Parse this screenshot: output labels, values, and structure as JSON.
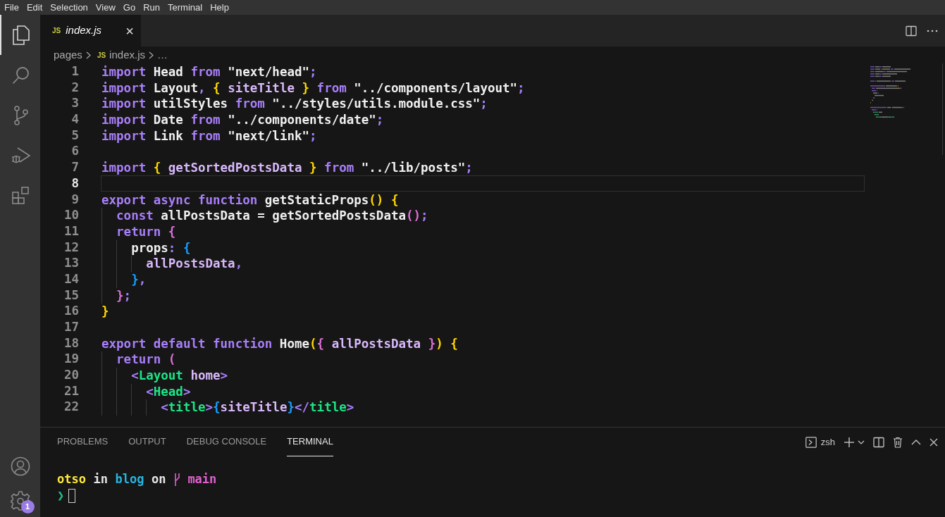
{
  "menu_bar": [
    "File",
    "Edit",
    "Selection",
    "View",
    "Go",
    "Run",
    "Terminal",
    "Help"
  ],
  "activity_bar": {
    "items": [
      {
        "kind": "files",
        "selected": true
      },
      {
        "kind": "search",
        "selected": false
      },
      {
        "kind": "source-control",
        "selected": false
      },
      {
        "kind": "run-debug",
        "selected": false
      },
      {
        "kind": "extensions",
        "selected": false
      }
    ],
    "settings_badge": "1"
  },
  "tabs": [
    {
      "icon_label": "JS",
      "label": "index.js",
      "selected": true,
      "close": "×"
    }
  ],
  "breadcrumb": {
    "folder": "pages",
    "file_icon_label": "JS",
    "file": "index.js",
    "more": "…"
  },
  "editor": {
    "lines": [
      {
        "number": "1",
        "current": false,
        "tokens": [
          {
            "t": "import",
            "kind": "keyword"
          },
          {
            "t": " Head ",
            "kind": "plain"
          },
          {
            "t": "from",
            "kind": "keyword"
          },
          {
            "t": " \"next/head\"",
            "kind": "plain"
          },
          {
            "t": ";",
            "kind": "punct"
          }
        ]
      },
      {
        "number": "2",
        "current": false,
        "tokens": [
          {
            "t": "import",
            "kind": "keyword"
          },
          {
            "t": " Layout",
            "kind": "plain"
          },
          {
            "t": ",",
            "kind": "punct"
          },
          {
            "t": " {",
            "kind": "brace1"
          },
          {
            "t": " siteTitle ",
            "kind": "variable"
          },
          {
            "t": "}",
            "kind": "brace1"
          },
          {
            "t": " from",
            "kind": "keyword"
          },
          {
            "t": " \"../components/layout\"",
            "kind": "plain"
          },
          {
            "t": ";",
            "kind": "punct"
          }
        ]
      },
      {
        "number": "3",
        "current": false,
        "tokens": [
          {
            "t": "import",
            "kind": "keyword"
          },
          {
            "t": " utilStyles ",
            "kind": "plain"
          },
          {
            "t": "from",
            "kind": "keyword"
          },
          {
            "t": " \"../styles/utils.module.css\"",
            "kind": "plain"
          },
          {
            "t": ";",
            "kind": "punct"
          }
        ]
      },
      {
        "number": "4",
        "current": false,
        "tokens": [
          {
            "t": "import",
            "kind": "keyword"
          },
          {
            "t": " Date ",
            "kind": "plain"
          },
          {
            "t": "from",
            "kind": "keyword"
          },
          {
            "t": " \"../components/date\"",
            "kind": "plain"
          },
          {
            "t": ";",
            "kind": "punct"
          }
        ]
      },
      {
        "number": "5",
        "current": false,
        "tokens": [
          {
            "t": "import",
            "kind": "keyword"
          },
          {
            "t": " Link ",
            "kind": "plain"
          },
          {
            "t": "from",
            "kind": "keyword"
          },
          {
            "t": " \"next/link\"",
            "kind": "plain"
          },
          {
            "t": ";",
            "kind": "punct"
          }
        ]
      },
      {
        "number": "6",
        "current": false
      },
      {
        "number": "7",
        "current": false,
        "tokens": [
          {
            "t": "import",
            "kind": "keyword"
          },
          {
            "t": " {",
            "kind": "brace1"
          },
          {
            "t": " getSortedPostsData ",
            "kind": "variable"
          },
          {
            "t": "}",
            "kind": "brace1"
          },
          {
            "t": " from",
            "kind": "keyword"
          },
          {
            "t": " \"../lib/posts\"",
            "kind": "plain"
          },
          {
            "t": ";",
            "kind": "punct"
          }
        ]
      },
      {
        "number": "8",
        "current": true
      },
      {
        "number": "9",
        "current": false,
        "tokens": [
          {
            "t": "export async function",
            "kind": "keyword"
          },
          {
            "t": " getStaticProps",
            "kind": "plain"
          },
          {
            "t": "()",
            "kind": "brace1"
          },
          {
            "t": " {",
            "kind": "brace1"
          }
        ]
      },
      {
        "number": "10",
        "current": false,
        "tokens": [
          {
            "t": "  const",
            "kind": "keyword"
          },
          {
            "t": " allPostsData = getSortedPostsData",
            "kind": "plain"
          },
          {
            "t": "()",
            "kind": "brace2"
          },
          {
            "t": ";",
            "kind": "punct"
          }
        ]
      },
      {
        "number": "11",
        "current": false,
        "tokens": [
          {
            "t": "  return",
            "kind": "keyword"
          },
          {
            "t": " {",
            "kind": "brace2"
          }
        ]
      },
      {
        "number": "12",
        "current": false,
        "tokens": [
          {
            "t": "    props",
            "kind": "plain"
          },
          {
            "t": ":",
            "kind": "punct"
          },
          {
            "t": " {",
            "kind": "brace3"
          }
        ]
      },
      {
        "number": "13",
        "current": false,
        "tokens": [
          {
            "t": "      allPostsData",
            "kind": "variable"
          },
          {
            "t": ",",
            "kind": "punct"
          }
        ]
      },
      {
        "number": "14",
        "current": false,
        "tokens": [
          {
            "t": "    }",
            "kind": "brace3"
          },
          {
            "t": ",",
            "kind": "punct"
          }
        ]
      },
      {
        "number": "15",
        "current": false,
        "tokens": [
          {
            "t": "  }",
            "kind": "brace2"
          },
          {
            "t": ";",
            "kind": "punct"
          }
        ]
      },
      {
        "number": "16",
        "current": false,
        "tokens": [
          {
            "t": "}",
            "kind": "brace1"
          }
        ]
      },
      {
        "number": "17",
        "current": false
      },
      {
        "number": "18",
        "current": false,
        "tokens": [
          {
            "t": "export default function",
            "kind": "keyword"
          },
          {
            "t": " Home",
            "kind": "plain"
          },
          {
            "t": "(",
            "kind": "brace1"
          },
          {
            "t": "{",
            "kind": "brace2"
          },
          {
            "t": " allPostsData ",
            "kind": "variable"
          },
          {
            "t": "}",
            "kind": "brace2"
          },
          {
            "t": ")",
            "kind": "brace1"
          },
          {
            "t": " {",
            "kind": "brace1"
          }
        ]
      },
      {
        "number": "19",
        "current": false,
        "tokens": [
          {
            "t": "  return",
            "kind": "keyword"
          },
          {
            "t": " (",
            "kind": "brace2"
          }
        ]
      },
      {
        "number": "20",
        "current": false,
        "tokens": [
          {
            "t": "    <",
            "kind": "tag-bracket"
          },
          {
            "t": "Layout",
            "kind": "tag"
          },
          {
            "t": " home",
            "kind": "attribute"
          },
          {
            "t": ">",
            "kind": "tag-bracket"
          }
        ]
      },
      {
        "number": "21",
        "current": false,
        "tokens": [
          {
            "t": "      <",
            "kind": "tag-bracket"
          },
          {
            "t": "Head",
            "kind": "tag"
          },
          {
            "t": ">",
            "kind": "tag-bracket"
          }
        ]
      },
      {
        "number": "22",
        "current": false,
        "tokens": [
          {
            "t": "        <",
            "kind": "tag-bracket"
          },
          {
            "t": "title",
            "kind": "tag"
          },
          {
            "t": ">",
            "kind": "tag-bracket"
          },
          {
            "t": "{",
            "kind": "brace3"
          },
          {
            "t": "siteTitle",
            "kind": "variable"
          },
          {
            "t": "}",
            "kind": "brace3"
          },
          {
            "t": "</",
            "kind": "tag-bracket"
          },
          {
            "t": "title",
            "kind": "tag"
          },
          {
            "t": ">",
            "kind": "tag-bracket"
          }
        ]
      }
    ]
  },
  "panel": {
    "tabs": [
      {
        "label": "PROBLEMS",
        "selected": false
      },
      {
        "label": "OUTPUT",
        "selected": false
      },
      {
        "label": "DEBUG CONSOLE",
        "selected": false
      },
      {
        "label": "TERMINAL",
        "selected": true
      }
    ],
    "shell": "zsh",
    "terminal": {
      "user": "otso",
      "in": "in",
      "dir": "blog",
      "on": "on",
      "branch": "main",
      "prompt": "❯"
    }
  }
}
